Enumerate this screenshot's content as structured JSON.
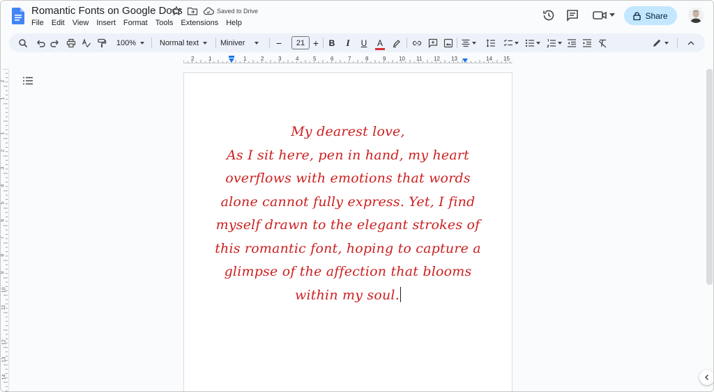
{
  "document": {
    "title": "Romantic Fonts on Google Docs",
    "save_status": "Saved to Drive"
  },
  "menu": [
    "File",
    "Edit",
    "View",
    "Insert",
    "Format",
    "Tools",
    "Extensions",
    "Help"
  ],
  "header": {
    "share_label": "Share"
  },
  "toolbar": {
    "zoom": "100%",
    "paragraph_style": "Normal text",
    "font_name": "Miniver",
    "font_size": "21",
    "bold_label": "B",
    "italic_label": "I",
    "underline_label": "U",
    "text_color_label": "A",
    "text_color": "#d32f2f"
  },
  "ruler": {
    "numbers": [
      "2",
      "1",
      "1",
      "2",
      "3",
      "4",
      "5",
      "6",
      "7",
      "8",
      "9",
      "10",
      "11",
      "12",
      "13",
      "14",
      "15"
    ]
  },
  "vertical_ruler": {
    "numbers": [
      "2",
      "1",
      "1",
      "2",
      "3",
      "4",
      "5",
      "6",
      "7",
      "8",
      "9",
      "10",
      "11",
      "12",
      "13",
      "14"
    ]
  },
  "content": {
    "text_color": "#cc1f1f",
    "lines": [
      "My dearest love,",
      "As I sit here, pen in hand, my heart",
      "overflows with emotions that words",
      "alone cannot fully express. Yet, I find",
      "myself drawn to the elegant strokes of",
      "this romantic font, hoping to capture a",
      "glimpse of the affection that blooms",
      "within my soul."
    ]
  },
  "colors": {
    "share_bg": "#c2e7ff",
    "toolbar_bg": "#edf2fa",
    "doc_blue": "#1a73e8"
  }
}
